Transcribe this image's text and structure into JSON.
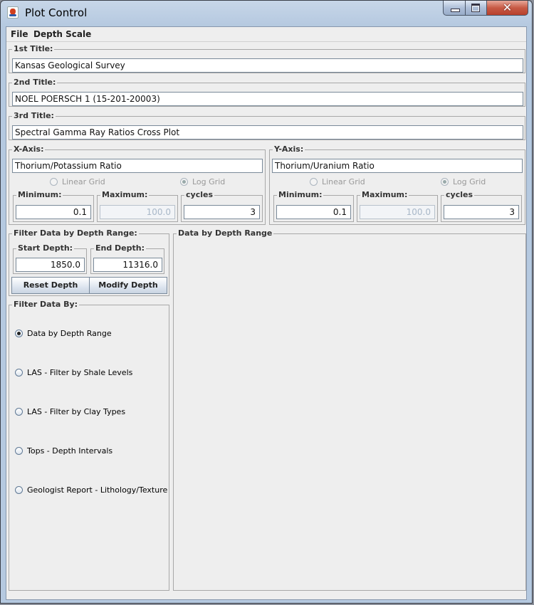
{
  "window": {
    "title": "Plot Control"
  },
  "menu": {
    "items": [
      "File",
      "Depth Scale"
    ]
  },
  "titles": {
    "first": {
      "label": "1st Title:",
      "value": "Kansas Geological Survey"
    },
    "second": {
      "label": "2nd Title:",
      "value": "NOEL POERSCH 1 (15-201-20003)"
    },
    "third": {
      "label": "3rd Title:",
      "value": "Spectral Gamma Ray Ratios Cross Plot"
    }
  },
  "x_axis": {
    "label": "X-Axis:",
    "title_value": "Thorium/Potassium Ratio",
    "linear_grid_label": "Linear Grid",
    "log_grid_label": "Log Grid",
    "selected_grid": "Log Grid",
    "minimum_label": "Minimum:",
    "minimum_value": "0.1",
    "maximum_label": "Maximum:",
    "maximum_value": "100.0",
    "cycles_label": "cycles",
    "cycles_value": "3"
  },
  "y_axis": {
    "label": "Y-Axis:",
    "title_value": "Thorium/Uranium Ratio",
    "linear_grid_label": "Linear Grid",
    "log_grid_label": "Log Grid",
    "selected_grid": "Log Grid",
    "minimum_label": "Minimum:",
    "minimum_value": "0.1",
    "maximum_label": "Maximum:",
    "maximum_value": "100.0",
    "cycles_label": "cycles",
    "cycles_value": "3"
  },
  "depth_filter": {
    "label": "Filter Data by Depth Range:",
    "start_label": "Start Depth:",
    "start_value": "1850.0",
    "end_label": "End Depth:",
    "end_value": "11316.0",
    "reset_button": "Reset Depth",
    "modify_button": "Modify Depth"
  },
  "filter_by": {
    "label": "Filter Data By:",
    "options": [
      "Data by Depth Range",
      "LAS - Filter by Shale Levels",
      "LAS - Filter by Clay Types",
      "Tops - Depth Intervals",
      "Geologist Report - Lithology/Texture"
    ],
    "selected": "Data by Depth Range"
  },
  "data_panel": {
    "label": "Data by Depth Range"
  }
}
